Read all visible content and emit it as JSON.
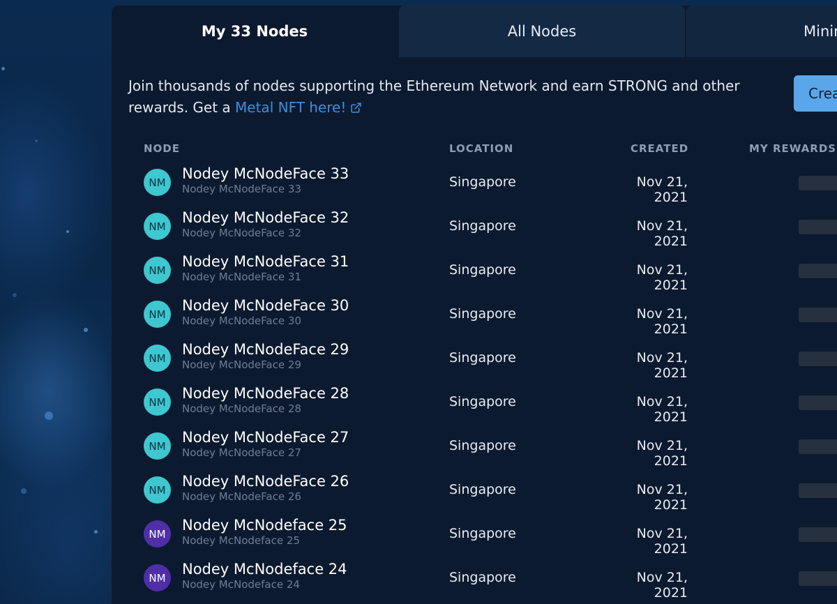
{
  "tabs": [
    {
      "label": "My 33 Nodes",
      "active": true
    },
    {
      "label": "All Nodes",
      "active": false
    },
    {
      "label": "Minin",
      "active": false
    }
  ],
  "intro": {
    "text": "Join thousands of nodes supporting the Ethereum Network and earn STRONG and other rewards. Get a ",
    "link_label": "Metal NFT here!",
    "link_icon": "external-link-icon"
  },
  "create_button": {
    "label": "Crea"
  },
  "columns": {
    "node": "NODE",
    "location": "LOCATION",
    "created": "CREATED",
    "rewards": "MY REWARDS"
  },
  "colors": {
    "accent": "#5aa6ea",
    "link": "#3d8fe0",
    "avatar_teal": "#3ec7cf",
    "avatar_purple": "#4f2ea8"
  },
  "rows": [
    {
      "initials": "NM",
      "name": "Nodey McNodeFace 33",
      "sub": "Nodey McNodeFace 33",
      "location": "Singapore",
      "created": "Nov 21, 2021",
      "avatar_color": "teal"
    },
    {
      "initials": "NM",
      "name": "Nodey McNodeFace 32",
      "sub": "Nodey McNodeFace 32",
      "location": "Singapore",
      "created": "Nov 21, 2021",
      "avatar_color": "teal"
    },
    {
      "initials": "NM",
      "name": "Nodey McNodeFace 31",
      "sub": "Nodey McNodeFace 31",
      "location": "Singapore",
      "created": "Nov 21, 2021",
      "avatar_color": "teal"
    },
    {
      "initials": "NM",
      "name": "Nodey McNodeFace 30",
      "sub": "Nodey McNodeFace 30",
      "location": "Singapore",
      "created": "Nov 21, 2021",
      "avatar_color": "teal"
    },
    {
      "initials": "NM",
      "name": "Nodey McNodeFace 29",
      "sub": "Nodey McNodeFace 29",
      "location": "Singapore",
      "created": "Nov 21, 2021",
      "avatar_color": "teal"
    },
    {
      "initials": "NM",
      "name": "Nodey McNodeFace 28",
      "sub": "Nodey McNodeFace 28",
      "location": "Singapore",
      "created": "Nov 21, 2021",
      "avatar_color": "teal"
    },
    {
      "initials": "NM",
      "name": "Nodey McNodeFace 27",
      "sub": "Nodey McNodeFace 27",
      "location": "Singapore",
      "created": "Nov 21, 2021",
      "avatar_color": "teal"
    },
    {
      "initials": "NM",
      "name": "Nodey McNodeFace 26",
      "sub": "Nodey McNodeFace 26",
      "location": "Singapore",
      "created": "Nov 21, 2021",
      "avatar_color": "teal"
    },
    {
      "initials": "NM",
      "name": "Nodey McNodeface 25",
      "sub": "Nodey McNodeface 25",
      "location": "Singapore",
      "created": "Nov 21, 2021",
      "avatar_color": "purple"
    },
    {
      "initials": "NM",
      "name": "Nodey McNodeface 24",
      "sub": "Nodey McNodeface 24",
      "location": "Singapore",
      "created": "Nov 21, 2021",
      "avatar_color": "purple"
    }
  ]
}
